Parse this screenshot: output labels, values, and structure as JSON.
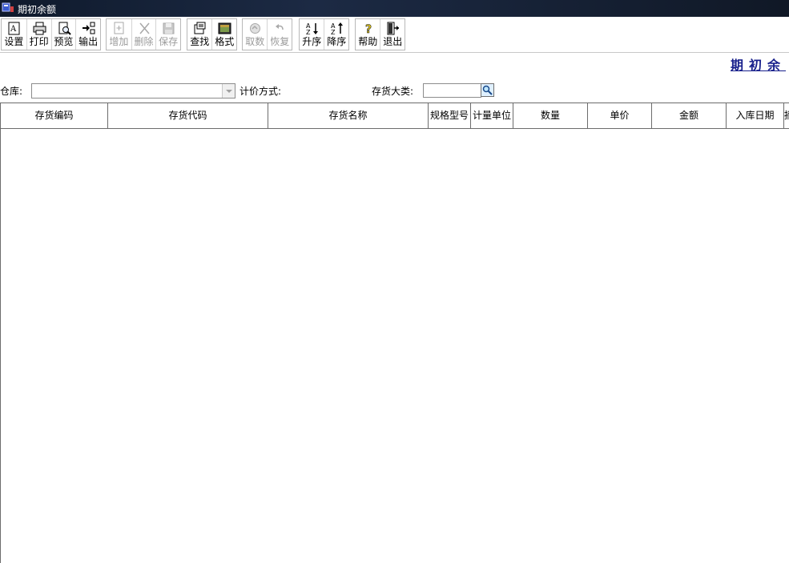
{
  "window": {
    "title": "期初余额",
    "app_icon": "app-window-icon"
  },
  "toolbar": {
    "groups": [
      [
        {
          "label": "设置",
          "icon": "settings-icon",
          "enabled": true
        },
        {
          "label": "打印",
          "icon": "printer-icon",
          "enabled": true
        },
        {
          "label": "预览",
          "icon": "preview-icon",
          "enabled": true
        },
        {
          "label": "输出",
          "icon": "export-icon",
          "enabled": true
        }
      ],
      [
        {
          "label": "增加",
          "icon": "add-icon",
          "enabled": false
        },
        {
          "label": "删除",
          "icon": "delete-icon",
          "enabled": false
        },
        {
          "label": "保存",
          "icon": "save-icon",
          "enabled": false
        }
      ],
      [
        {
          "label": "查找",
          "icon": "find-icon",
          "enabled": true
        },
        {
          "label": "格式",
          "icon": "format-icon",
          "enabled": true
        }
      ],
      [
        {
          "label": "取数",
          "icon": "fetch-icon",
          "enabled": false
        },
        {
          "label": "恢复",
          "icon": "undo-icon",
          "enabled": false
        }
      ],
      [
        {
          "label": "升序",
          "icon": "sort-ascending-icon",
          "enabled": true
        },
        {
          "label": "降序",
          "icon": "sort-descending-icon",
          "enabled": true
        }
      ],
      [
        {
          "label": "帮助",
          "icon": "help-icon",
          "enabled": true
        },
        {
          "label": "退出",
          "icon": "exit-icon",
          "enabled": true
        }
      ]
    ]
  },
  "report_title": "期初余",
  "filters": {
    "warehouse_label": "仓库:",
    "warehouse_value": "",
    "pricing_label": "计价方式:",
    "category_label": "存货大类:",
    "category_value": ""
  },
  "grid": {
    "columns": [
      "存货编码",
      "存货代码",
      "存货名称",
      "规格型号",
      "计量单位",
      "数量",
      "单价",
      "金额",
      "入库日期",
      "摘"
    ],
    "rows": []
  },
  "colors": {
    "title_bar": "#0f1a2c",
    "report_title": "#18208c",
    "disabled_text": "#9a9a9a"
  }
}
